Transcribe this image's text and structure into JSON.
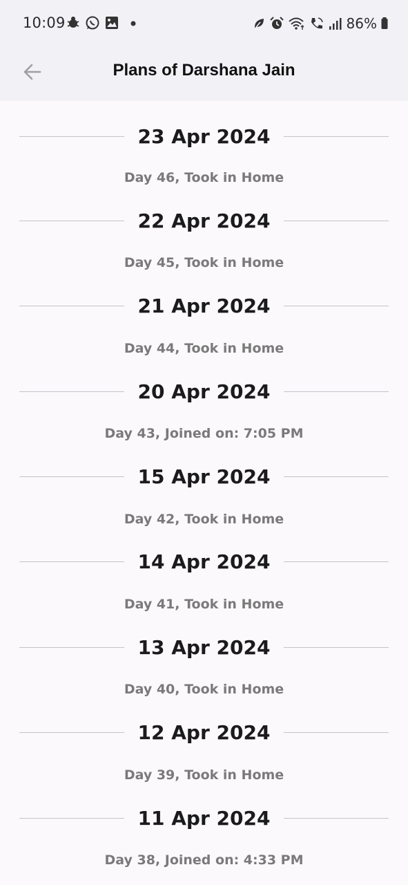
{
  "status_bar": {
    "time": "10:09",
    "battery": "86%",
    "left_icons": [
      "bug-icon",
      "whatsapp-icon",
      "gallery-icon",
      "dot-icon"
    ],
    "right_icons": [
      "leaf-icon",
      "alarm-icon",
      "wifi-icon",
      "wifi-call-icon",
      "signal-icon",
      "battery-icon"
    ]
  },
  "header": {
    "title": "Plans of Darshana Jain",
    "back_icon": "back-arrow-icon"
  },
  "plans": [
    {
      "date": "23 Apr 2024",
      "detail": "Day 46, Took in Home"
    },
    {
      "date": "22 Apr 2024",
      "detail": "Day 45, Took in Home"
    },
    {
      "date": "21 Apr 2024",
      "detail": "Day 44, Took in Home"
    },
    {
      "date": "20 Apr 2024",
      "detail": "Day 43, Joined on: 7:05 PM"
    },
    {
      "date": "15 Apr 2024",
      "detail": "Day 42, Took in Home"
    },
    {
      "date": "14 Apr 2024",
      "detail": "Day 41, Took in Home"
    },
    {
      "date": "13 Apr 2024",
      "detail": "Day 40, Took in Home"
    },
    {
      "date": "12 Apr 2024",
      "detail": "Day 39, Took in Home"
    },
    {
      "date": "11 Apr 2024",
      "detail": "Day 38, Joined on: 4:33 PM"
    }
  ],
  "colors": {
    "background": "#fcf9fc",
    "app_bar": "#f2f1f6",
    "date_text": "#1b1b1d",
    "detail_text": "#7a7a7a",
    "divider": "#c6c3c8"
  }
}
